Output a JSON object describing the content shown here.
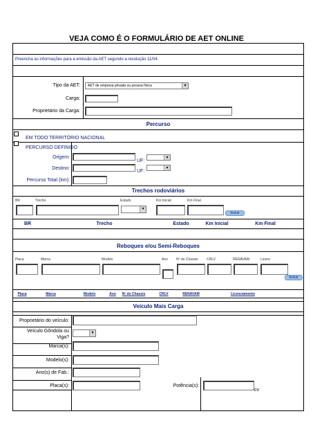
{
  "title": "VEJA COMO É O FORMULÁRIO DE AET ONLINE",
  "intro": "Preencha as informações para a emissão da AET segundo a resolução 11/04:",
  "general": {
    "tipo_label": "Tipo da AET:",
    "tipo_value": "AET de empresa privada ou pessoa física",
    "carga_label": "Carga:",
    "proprietario_label": "Proprietário da Carga:"
  },
  "percurso": {
    "header": "Percurso",
    "option_todo": "EM TODO TERRITÓRIO NACIONAL",
    "option_definido": "PERCURSO DEFINIDO",
    "origem_label": "Origem:",
    "destino_label": "Destino:",
    "uf_label": "UF:",
    "total_label": "Percurso Total (km):"
  },
  "trechos": {
    "header": "Trechos rodoviários",
    "cols": [
      "BR",
      "Trecho",
      "Estado",
      "Km Inicial",
      "Km Final"
    ],
    "add_button": "Incluir",
    "table_cols": [
      "BR",
      "Trecho",
      "Estado",
      "Km Inicial",
      "Km Final"
    ]
  },
  "reboques": {
    "header": "Reboques e/ou Semi-Reboques",
    "cols": [
      "Placa",
      "Marca",
      "Modelo",
      "Ano",
      "Nº do Chassis",
      "CRLV",
      "RENAVAM",
      "Licenc"
    ],
    "add_button": "Incluir",
    "table_cols": [
      "Placa",
      "Marca",
      "Modelo",
      "Ano",
      "Nº do Chassis",
      "CRLV",
      "RENAVAM",
      "Licenciamento"
    ]
  },
  "veiculo": {
    "header": "Veículo Mais Carga",
    "proprietario_label": "Proprietário do veículo:",
    "gondola_label_1": "Veículo Gôndola ou",
    "gondola_label_2": "Viga?",
    "marca_label": "Marca(s):",
    "modelo_label": "Modelo(s):",
    "ano_label": "Ano(s) de Fab.:",
    "placa_label": "Placa(s):",
    "potencia_label": "Potência(s):",
    "potencia_unit": "cv"
  }
}
